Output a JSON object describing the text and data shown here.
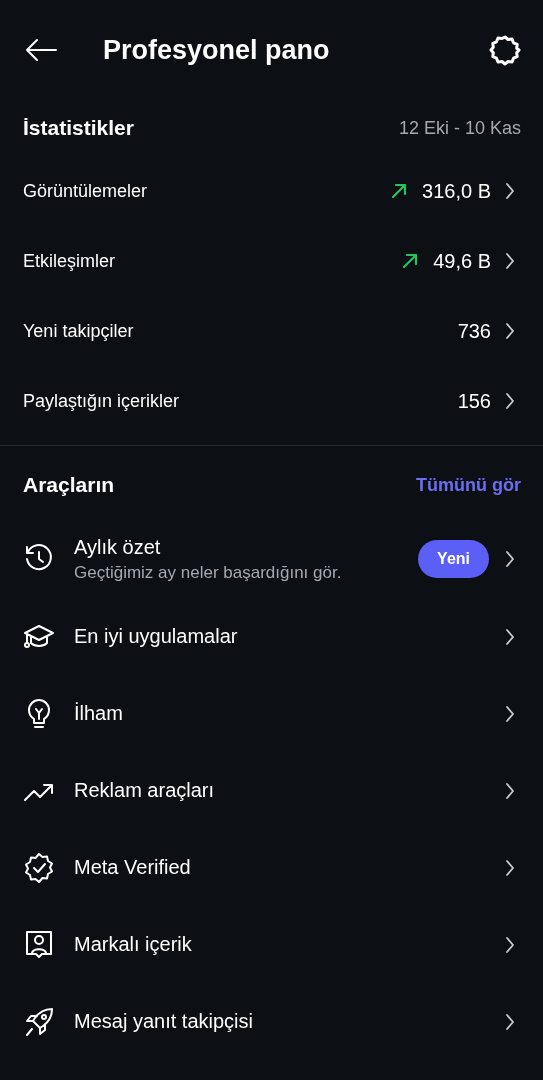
{
  "header": {
    "title": "Profesyonel pano"
  },
  "stats": {
    "title": "İstatistikler",
    "range": "12 Eki - 10 Kas",
    "rows": [
      {
        "label": "Görüntülemeler",
        "value": "316,0 B",
        "trending_up": true
      },
      {
        "label": "Etkileşimler",
        "value": "49,6 B",
        "trending_up": true
      },
      {
        "label": "Yeni takipçiler",
        "value": "736",
        "trending_up": false
      },
      {
        "label": "Paylaştığın içerikler",
        "value": "156",
        "trending_up": false
      }
    ]
  },
  "tools": {
    "title": "Araçların",
    "link": "Tümünü gör",
    "items": [
      {
        "kind": "history",
        "label": "Aylık özet",
        "subtitle": "Geçtiğimiz ay neler başardığını gör.",
        "badge": "Yeni"
      },
      {
        "kind": "graduation",
        "label": "En iyi uygulamalar"
      },
      {
        "kind": "bulb",
        "label": "İlham"
      },
      {
        "kind": "trend",
        "label": "Reklam araçları"
      },
      {
        "kind": "verified",
        "label": "Meta Verified"
      },
      {
        "kind": "person",
        "label": "Markalı içerik"
      },
      {
        "kind": "rocket",
        "label": "Mesaj yanıt takipçisi"
      }
    ]
  }
}
